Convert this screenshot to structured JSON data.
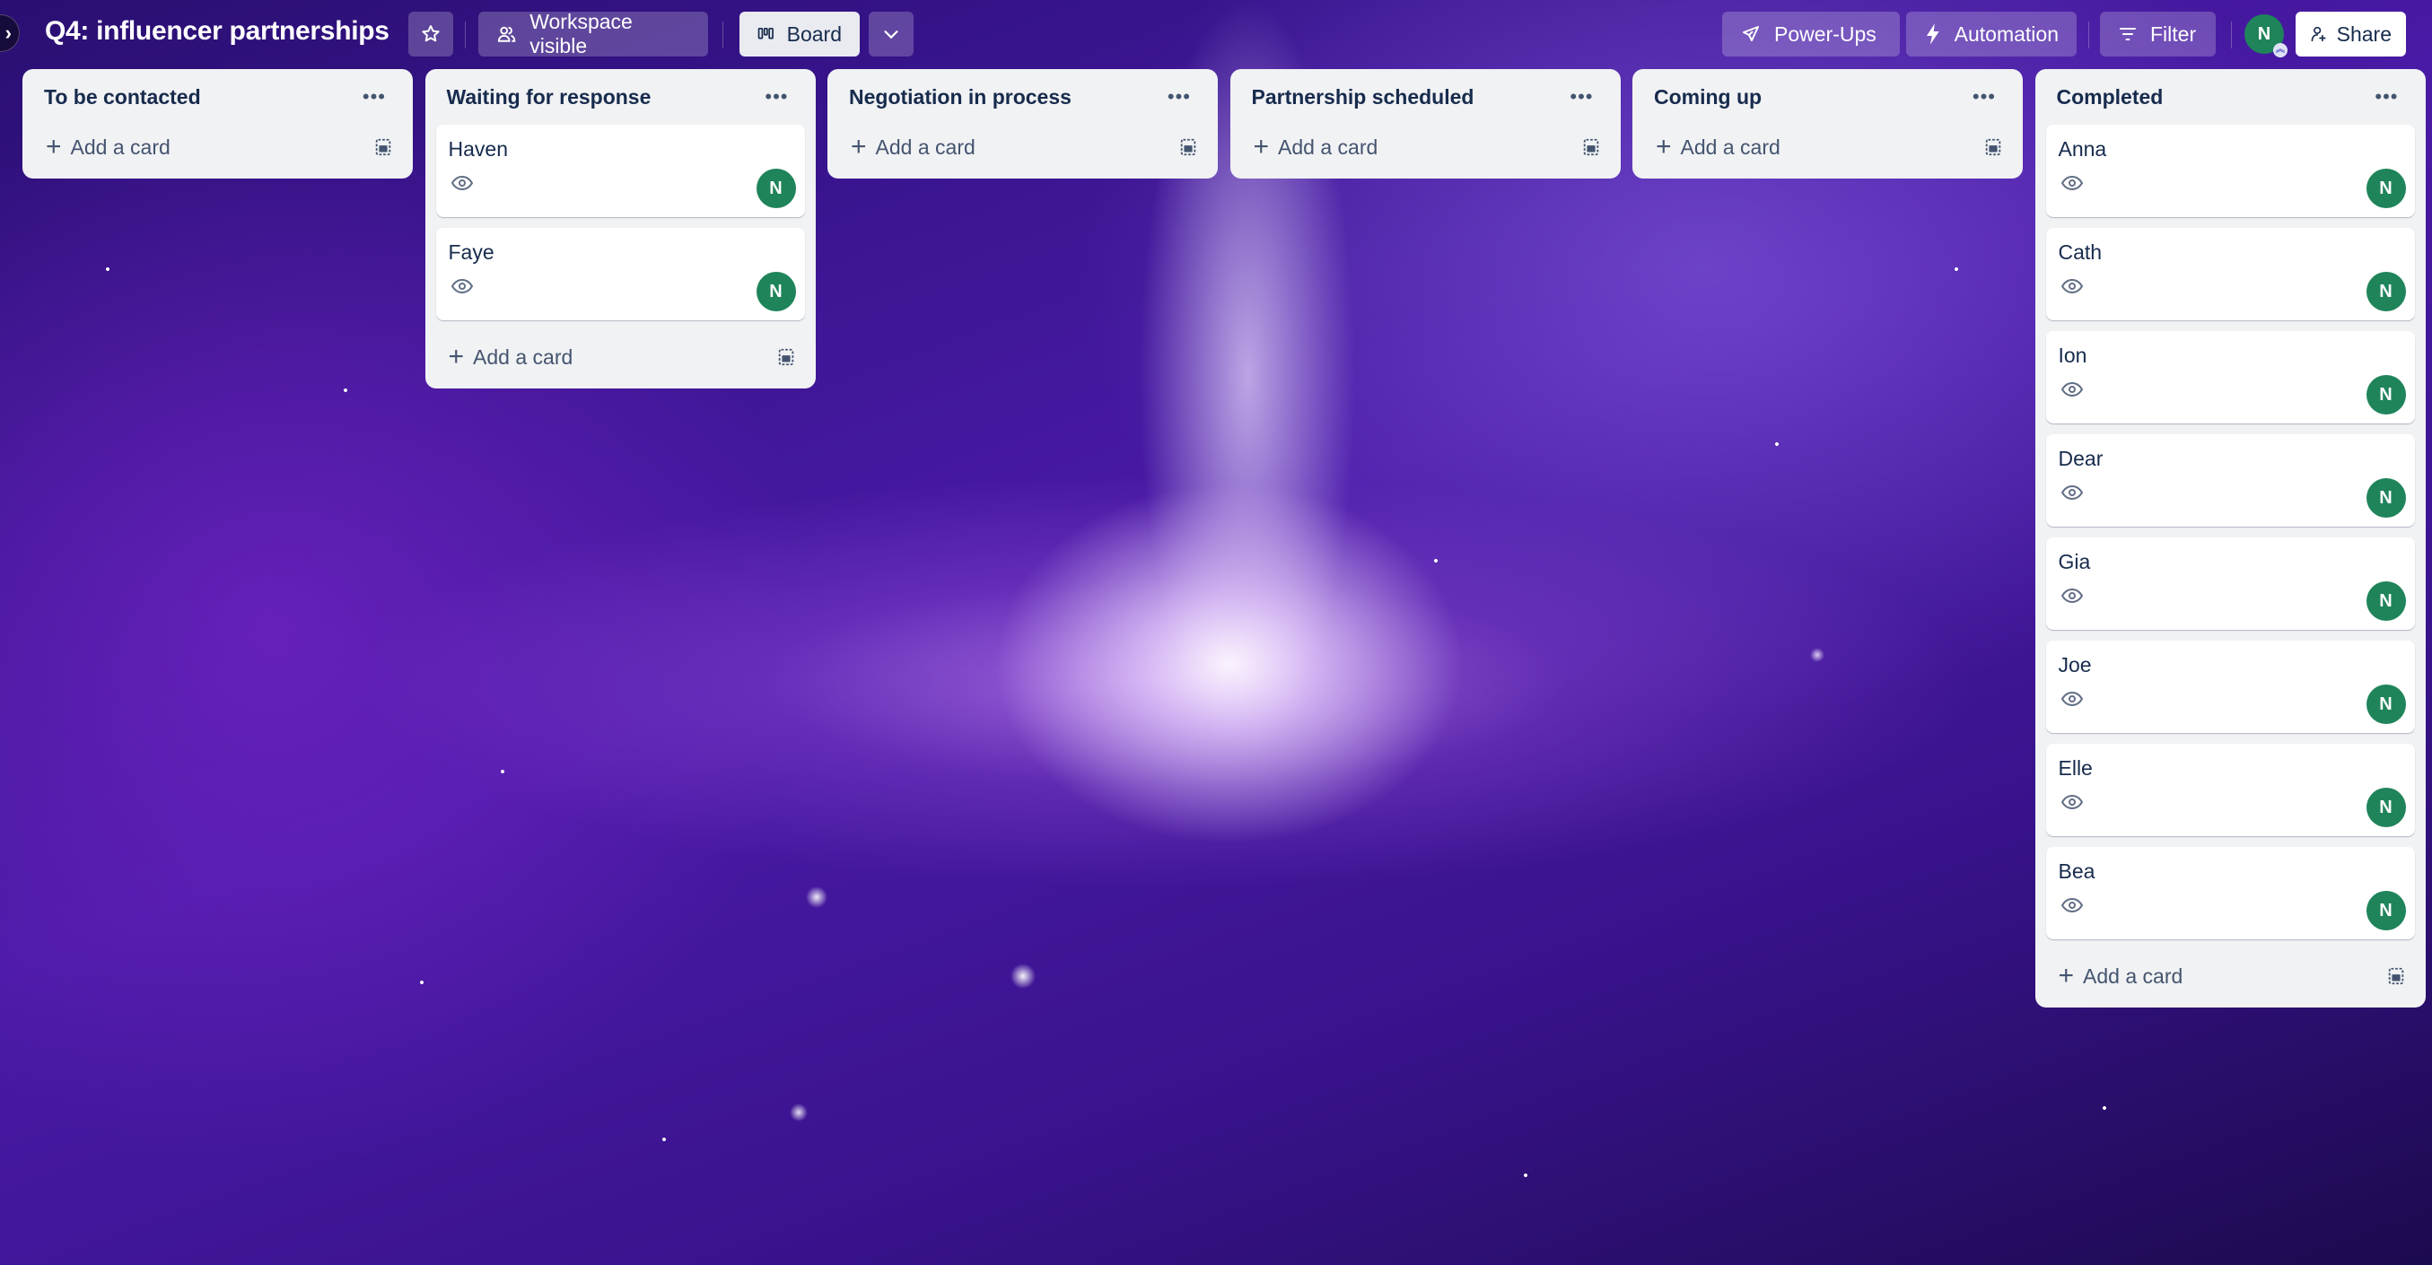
{
  "header": {
    "title": "Q4: influencer partnerships",
    "star_icon": "star-icon",
    "visibility_label": "Workspace visible",
    "view_label": "Board",
    "powerups_label": "Power-Ups",
    "automation_label": "Automation",
    "filter_label": "Filter",
    "member_initial": "N",
    "share_label": "Share"
  },
  "theme": {
    "avatar_color": "#1f845a",
    "list_bg": "#f1f2f4",
    "text_color": "#172b4d"
  },
  "lists": [
    {
      "title": "To be contacted",
      "cards": [],
      "add_label": "Add a card"
    },
    {
      "title": "Waiting for response",
      "cards": [
        {
          "title": "Haven",
          "member": "N"
        },
        {
          "title": "Faye",
          "member": "N"
        }
      ],
      "add_label": "Add a card"
    },
    {
      "title": "Negotiation in process",
      "cards": [],
      "add_label": "Add a card"
    },
    {
      "title": "Partnership scheduled",
      "cards": [],
      "add_label": "Add a card"
    },
    {
      "title": "Coming up",
      "cards": [],
      "add_label": "Add a card"
    },
    {
      "title": "Completed",
      "cards": [
        {
          "title": "Anna",
          "member": "N"
        },
        {
          "title": "Cath",
          "member": "N"
        },
        {
          "title": "Ion",
          "member": "N"
        },
        {
          "title": "Dear",
          "member": "N"
        },
        {
          "title": "Gia",
          "member": "N"
        },
        {
          "title": "Joe",
          "member": "N"
        },
        {
          "title": "Elle",
          "member": "N"
        },
        {
          "title": "Bea",
          "member": "N"
        }
      ],
      "add_label": "Add a card"
    }
  ]
}
